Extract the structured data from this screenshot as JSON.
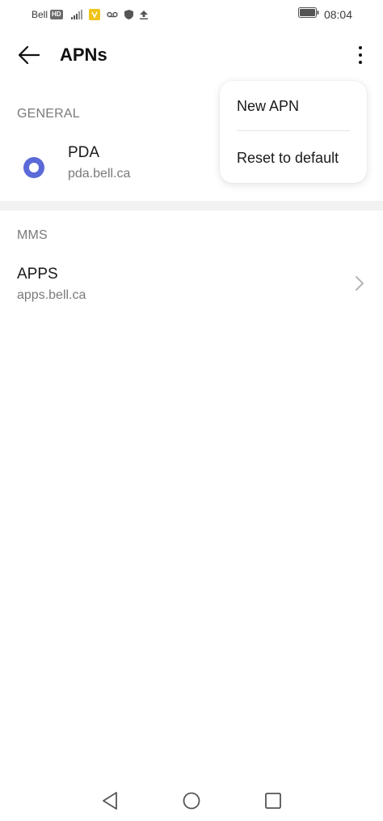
{
  "status_bar": {
    "carrier": "Bell",
    "hd_badge": "HD",
    "time": "08:04",
    "icons": [
      "signal-icon",
      "wifi-calling-icon",
      "voicemail-icon",
      "shield-icon",
      "upload-icon",
      "battery-icon"
    ]
  },
  "app_bar": {
    "title": "APNs",
    "back_icon": "arrow-left-icon",
    "more_icon": "more-vertical-icon"
  },
  "sections": [
    {
      "header": "GENERAL",
      "items": [
        {
          "name": "PDA",
          "apn": "pda.bell.ca",
          "selected": true
        }
      ]
    },
    {
      "header": "MMS",
      "items": [
        {
          "name": "APPS",
          "apn": "apps.bell.ca"
        }
      ]
    }
  ],
  "popup_menu": {
    "items": [
      "New APN",
      "Reset to default"
    ]
  },
  "colors": {
    "accent": "#5b6ad8",
    "secondary_text": "#7a7a7a"
  },
  "nav_bar": {
    "icons": [
      "nav-back-icon",
      "nav-home-icon",
      "nav-recents-icon"
    ]
  }
}
